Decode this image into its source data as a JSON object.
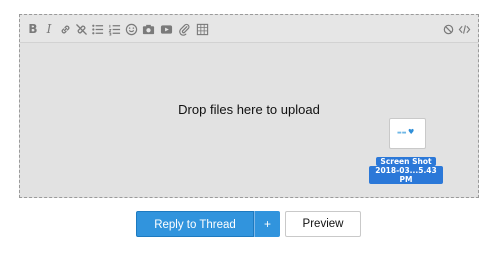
{
  "toolbar": {
    "bold": "B",
    "italic": "I"
  },
  "editor": {
    "drop_text": "Drop files here to upload"
  },
  "dragged_file": {
    "label_line1": "Screen Shot",
    "label_line2": "2018-03...5.43 PM"
  },
  "actions": {
    "reply_label": "Reply to Thread",
    "plus_label": "+",
    "preview_label": "Preview"
  },
  "colors": {
    "accent": "#3194dd",
    "editor_bg": "#e2e2e2",
    "selection": "#2b78d8"
  }
}
